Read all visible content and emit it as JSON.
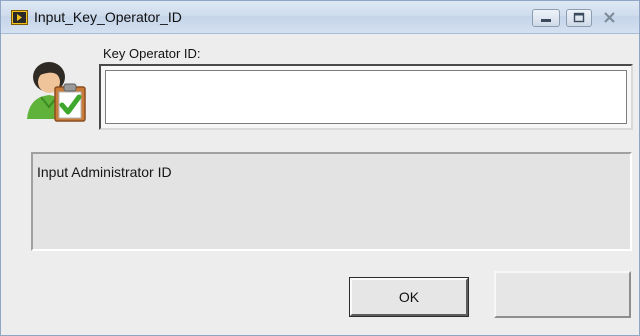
{
  "window": {
    "title": "Input_Key_Operator_ID",
    "icon": "labview-app-icon",
    "controls": [
      "minimize-icon",
      "maximize-icon",
      "close-icon"
    ]
  },
  "form": {
    "key_label": "Key Operator ID:",
    "key_value": "",
    "user_icon": "user-clipboard-check-icon"
  },
  "message": {
    "text": "Input Administrator ID"
  },
  "buttons": {
    "ok_label": "OK",
    "second_label": ""
  },
  "colors": {
    "window_bg": "#ededed",
    "titlebar": "#cfdcec",
    "input_bg": "#ffffff"
  }
}
